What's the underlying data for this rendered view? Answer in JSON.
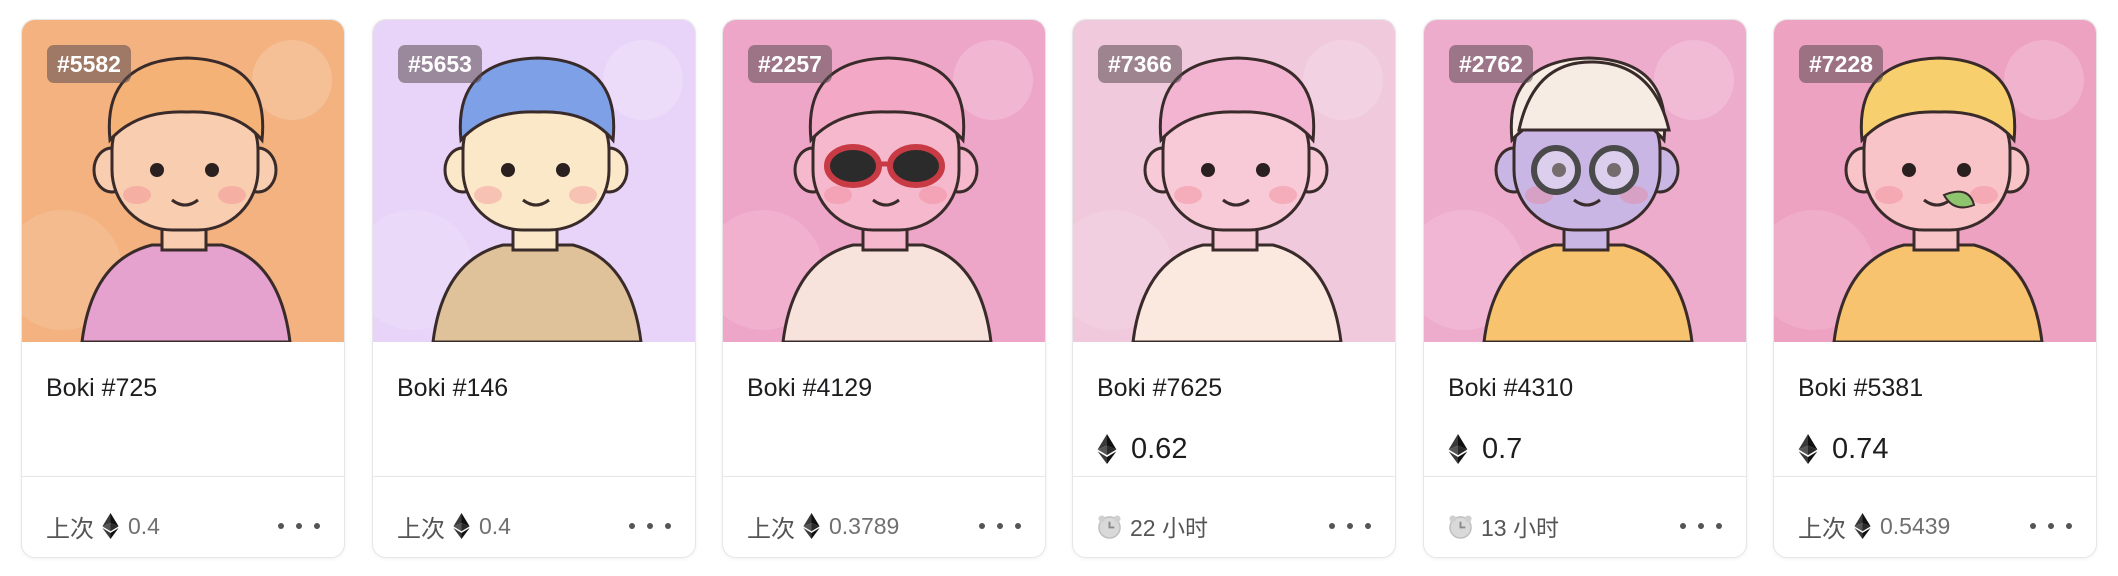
{
  "cards": [
    {
      "badge": "#5582",
      "name": "Boki #725",
      "price": "",
      "footer_label": "上次",
      "footer_value": "0.4",
      "footer_type": "last",
      "bg": "#f3b27f",
      "hair": "#f5b277",
      "skin": "#f8cdb0",
      "shirt": "#e6a2cf",
      "accessory": "none"
    },
    {
      "badge": "#5653",
      "name": "Boki #146",
      "price": "",
      "footer_label": "上次",
      "footer_value": "0.4",
      "footer_type": "last",
      "bg": "#e8d4f8",
      "hair": "#7ea0e6",
      "skin": "#fbe8c8",
      "shirt": "#dfc29a",
      "accessory": "none"
    },
    {
      "badge": "#2257",
      "name": "Boki #4129",
      "price": "",
      "footer_label": "上次",
      "footer_value": "0.3789",
      "footer_type": "last",
      "bg": "#eea6c8",
      "hair": "#f3a8c6",
      "skin": "#f6b8cc",
      "shirt": "#f7e3dc",
      "accessory": "sunglasses"
    },
    {
      "badge": "#7366",
      "name": "Boki #7625",
      "price": "0.62",
      "footer_label": "",
      "footer_value": "22 小时",
      "footer_type": "time",
      "bg": "#f0c9dc",
      "hair": "#f3b4d2",
      "skin": "#f8c9d6",
      "shirt": "#fbe9e0",
      "accessory": "none"
    },
    {
      "badge": "#2762",
      "name": "Boki #4310",
      "price": "0.7",
      "footer_label": "",
      "footer_value": "13 小时",
      "footer_type": "time",
      "bg": "#eeaccd",
      "hair": "#f7ece4",
      "skin": "#c9b6e4",
      "shirt": "#f7c36f",
      "accessory": "cap-glasses"
    },
    {
      "badge": "#7228",
      "name": "Boki #5381",
      "price": "0.74",
      "footer_label": "上次",
      "footer_value": "0.5439",
      "footer_type": "last",
      "bg": "#eea2c2",
      "hair": "#f7cf6d",
      "skin": "#f8c4c8",
      "shirt": "#f7c36f",
      "accessory": "leaf"
    }
  ]
}
